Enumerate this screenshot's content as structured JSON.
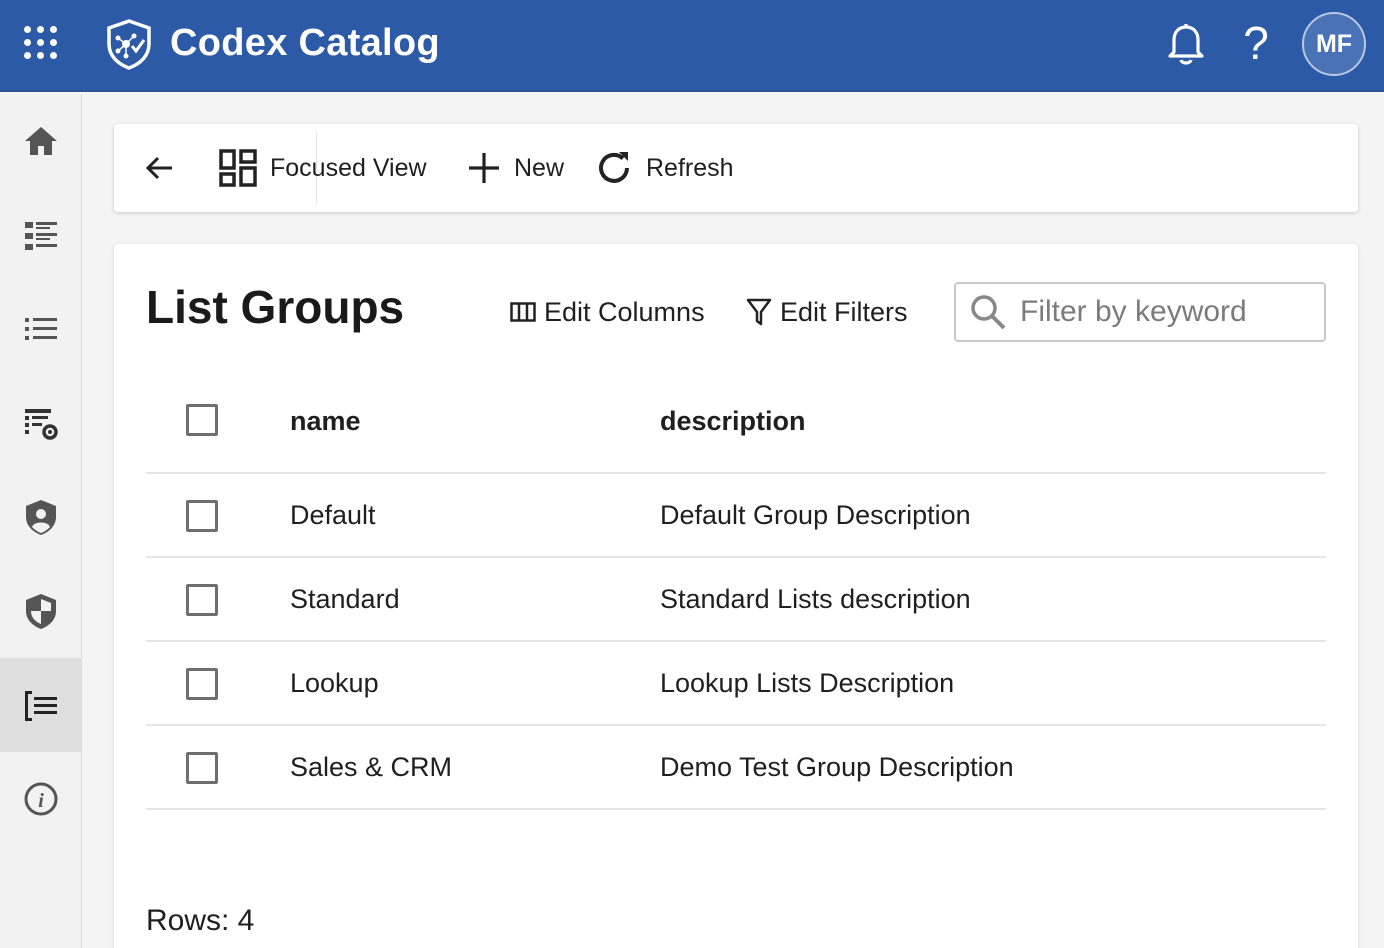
{
  "header": {
    "title": "Codex Catalog",
    "avatar_initials": "MF",
    "help_glyph": "?",
    "brand_color": "#2d5aa6",
    "icons": [
      "apps-grid-icon",
      "shield-network-logo-icon",
      "bell-icon",
      "help-icon"
    ]
  },
  "sidebar": {
    "items": [
      {
        "icon": "home-icon"
      },
      {
        "icon": "list-detail-icon"
      },
      {
        "icon": "list-bullets-icon"
      },
      {
        "icon": "table-settings-icon"
      },
      {
        "icon": "user-shield-icon"
      },
      {
        "icon": "shield-icon"
      },
      {
        "icon": "list-group-icon",
        "active": true
      },
      {
        "icon": "info-icon"
      }
    ]
  },
  "toolbar": {
    "focused_view_label": "Focused View",
    "new_label": "New",
    "refresh_label": "Refresh"
  },
  "main": {
    "title": "List Groups",
    "edit_columns_label": "Edit Columns",
    "edit_filters_label": "Edit Filters",
    "search_placeholder": "Filter by keyword",
    "columns": [
      "name",
      "description"
    ],
    "rows": [
      {
        "name": "Default",
        "description": "Default Group Description"
      },
      {
        "name": "Standard",
        "description": "Standard Lists description"
      },
      {
        "name": "Lookup",
        "description": "Lookup Lists Description"
      },
      {
        "name": "Sales & CRM",
        "description": "Demo Test Group Description"
      }
    ],
    "rows_count": "Rows: 4"
  }
}
